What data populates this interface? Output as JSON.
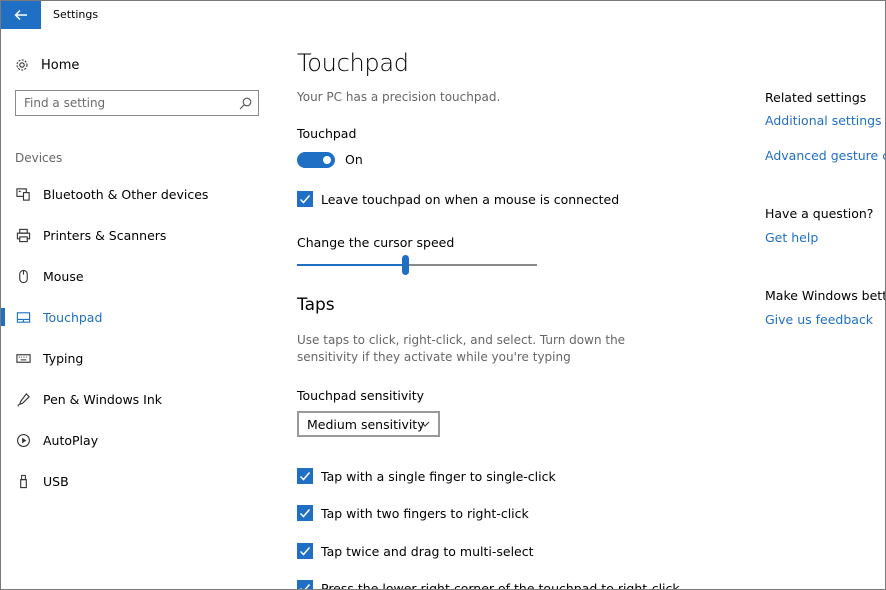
{
  "window": {
    "title": "Settings"
  },
  "sidebar": {
    "home_label": "Home",
    "search_placeholder": "Find a setting",
    "section": "Devices",
    "items": [
      {
        "label": "Bluetooth & Other devices",
        "icon": "bluetooth-devices-icon"
      },
      {
        "label": "Printers & Scanners",
        "icon": "printer-icon"
      },
      {
        "label": "Mouse",
        "icon": "mouse-icon"
      },
      {
        "label": "Touchpad",
        "icon": "touchpad-icon",
        "active": true
      },
      {
        "label": "Typing",
        "icon": "keyboard-icon"
      },
      {
        "label": "Pen & Windows Ink",
        "icon": "pen-icon"
      },
      {
        "label": "AutoPlay",
        "icon": "autoplay-icon"
      },
      {
        "label": "USB",
        "icon": "usb-icon"
      }
    ]
  },
  "main": {
    "title": "Touchpad",
    "subtitle": "Your PC has a precision touchpad.",
    "touchpad_label": "Touchpad",
    "toggle_state": "On",
    "leave_on_label": "Leave touchpad on when a mouse is connected",
    "cursor_speed_label": "Change the cursor speed",
    "cursor_speed_fraction": 0.45,
    "taps_heading": "Taps",
    "taps_description": "Use taps to click, right-click, and select. Turn down the sensitivity if they activate while you're typing",
    "sensitivity_label": "Touchpad sensitivity",
    "sensitivity_value": "Medium sensitivity",
    "tap_options": [
      "Tap with a single finger to single-click",
      "Tap with two fingers to right-click",
      "Tap twice and drag to multi-select",
      "Press the lower right corner of the touchpad to right-click"
    ]
  },
  "related": {
    "heading": "Related settings",
    "links": [
      "Additional settings",
      "Advanced gesture co"
    ],
    "question_heading": "Have a question?",
    "help_link": "Get help",
    "better_heading": "Make Windows bette",
    "feedback_link": "Give us feedback"
  },
  "colors": {
    "accent": "#1f6fc5"
  }
}
